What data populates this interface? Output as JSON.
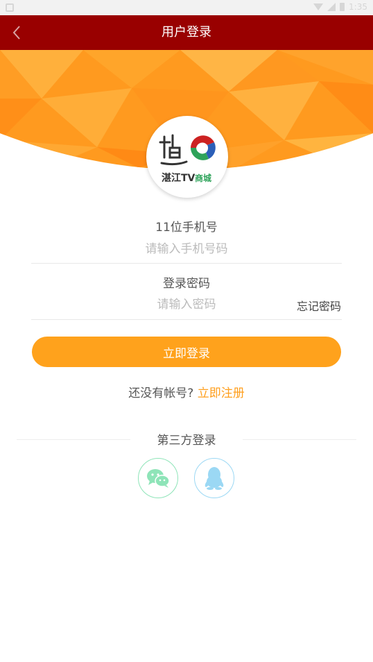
{
  "status_bar": {
    "time": "1:35"
  },
  "header": {
    "title": "用户登录"
  },
  "logo": {
    "tv_text": "湛江TV",
    "mall_text": "商城"
  },
  "phone": {
    "label": "11位手机号",
    "placeholder": "请输入手机号码",
    "value": ""
  },
  "password": {
    "label": "登录密码",
    "placeholder": "请输入密码",
    "value": "",
    "forgot_label": "忘记密码"
  },
  "login_button": {
    "label": "立即登录"
  },
  "register": {
    "prompt": "还没有帐号?",
    "link_label": "立即注册"
  },
  "third_party": {
    "title": "第三方登录",
    "options": [
      {
        "icon": "wechat-icon"
      },
      {
        "icon": "qq-icon"
      }
    ]
  },
  "colors": {
    "title_bar": "#990000",
    "accent": "#ffa21c",
    "wechat": "#8ee4b8",
    "qq": "#9bd8f4"
  }
}
